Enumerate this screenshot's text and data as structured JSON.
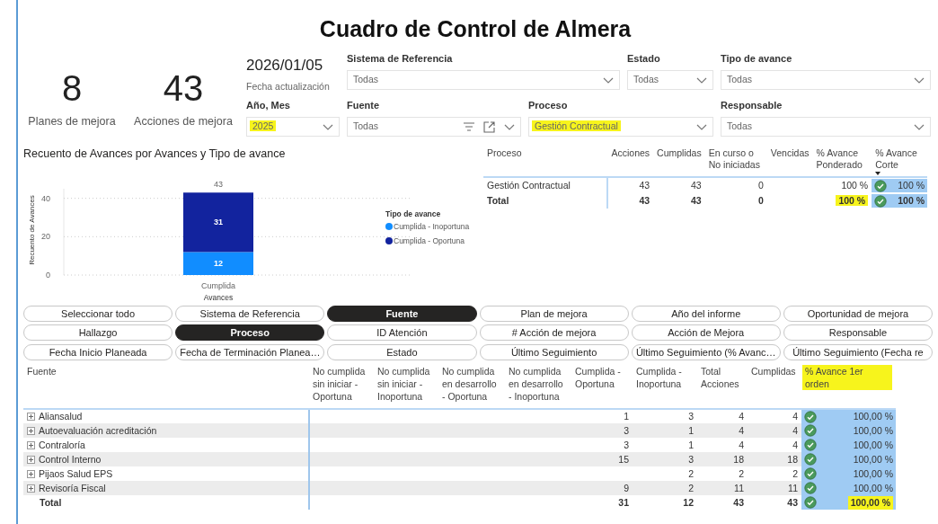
{
  "title": "Cuadro de Control de Almera",
  "kpis": [
    {
      "value": "8",
      "label": "Planes de mejora"
    },
    {
      "value": "43",
      "label": "Acciones de mejora"
    }
  ],
  "update_date": {
    "value": "2026/01/05",
    "label": "Fecha actualización"
  },
  "slicers": [
    {
      "label": "Sistema de Referencia",
      "value": "Todas",
      "highlighted": false
    },
    {
      "label": "Estado",
      "value": "Todas",
      "highlighted": false
    },
    {
      "label": "Tipo de avance",
      "value": "Todas",
      "highlighted": false
    },
    {
      "label": "Año, Mes",
      "value": "2025",
      "highlighted": true
    },
    {
      "label": "Fuente",
      "value": "Todas",
      "highlighted": false
    },
    {
      "label": "Proceso",
      "value": "Gestión Contractual",
      "highlighted": true
    },
    {
      "label": "Responsable",
      "value": "Todas",
      "highlighted": false
    }
  ],
  "chart": {
    "legend_title": "Tipo de avance",
    "chart_data": {
      "type": "bar",
      "stacked": true,
      "title": "Recuento de Avances por Avances y Tipo de avance",
      "xlabel": "Avances",
      "ylabel": "Recuento de Avances",
      "categories": [
        "Cumplida"
      ],
      "series": [
        {
          "name": "Cumplida - Inoportuna",
          "color": "#118dff",
          "values": [
            12
          ]
        },
        {
          "name": "Cumplida - Oportuna",
          "color": "#12239e",
          "values": [
            31
          ]
        }
      ],
      "ylim": [
        0,
        45
      ],
      "yticks": [
        0,
        20,
        40
      ],
      "data_labels": true,
      "legend": "right",
      "annotations": [
        "43"
      ]
    }
  },
  "summary": {
    "columns": [
      {
        "label": "Proceso",
        "sorted": false
      },
      {
        "label": "Acciones",
        "sorted": false
      },
      {
        "label": "Cumplidas",
        "sorted": false
      },
      {
        "label": "En curso o No iniciadas",
        "sorted": false
      },
      {
        "label": "Vencidas",
        "sorted": false
      },
      {
        "label": "% Avance Ponderado",
        "sorted": false
      },
      {
        "label": "% Avance Corte",
        "sorted": true
      }
    ],
    "rows": [
      {
        "kind": "row",
        "label": "Gestión Contractual",
        "acciones": "43",
        "cumplidas": "43",
        "en_curso": "0",
        "weighted": {
          "text": "100 %",
          "highlighted": false
        },
        "cut": "100 %"
      },
      {
        "kind": "total",
        "label": "Total",
        "acciones": "43",
        "cumplidas": "43",
        "en_curso": "0",
        "weighted": {
          "text": "100 %",
          "highlighted": true
        },
        "cut": "100 %"
      }
    ]
  },
  "field_buttons": [
    {
      "label": "Seleccionar todo",
      "selected": false
    },
    {
      "label": "Sistema de Referencia",
      "selected": false
    },
    {
      "label": "Fuente",
      "selected": true
    },
    {
      "label": "Plan de mejora",
      "selected": false
    },
    {
      "label": "Año del informe",
      "selected": false
    },
    {
      "label": "Oportunidad de mejora",
      "selected": false
    },
    {
      "label": "Hallazgo",
      "selected": false
    },
    {
      "label": "Proceso",
      "selected": true
    },
    {
      "label": "ID Atención",
      "selected": false
    },
    {
      "label": "# Acción de mejora",
      "selected": false
    },
    {
      "label": "Acción de Mejora",
      "selected": false
    },
    {
      "label": "Responsable",
      "selected": false
    },
    {
      "label": "Fecha Inicio Planeada",
      "selected": false
    },
    {
      "label": "Fecha de Terminación Planea…",
      "selected": false
    },
    {
      "label": "Estado",
      "selected": false
    },
    {
      "label": "Último Seguimiento",
      "selected": false
    },
    {
      "label": "Último Seguimiento (% Avanc…",
      "selected": false
    },
    {
      "label": "Último Seguimiento (Fecha re",
      "selected": false
    }
  ],
  "matrix": {
    "columns": [
      {
        "label": "Fuente",
        "highlighted": false
      },
      {
        "label": "No cumplida sin iniciar - Oportuna",
        "highlighted": false
      },
      {
        "label": "No cumplida sin iniciar - Inoportuna",
        "highlighted": false
      },
      {
        "label": "No cumplida en desarrollo - Oportuna",
        "highlighted": false
      },
      {
        "label": "No cumplida en desarrollo - Inoportuna",
        "highlighted": false
      },
      {
        "label": "Cumplida - Oportuna",
        "highlighted": false
      },
      {
        "label": "Cumplida - Inoportuna",
        "highlighted": false
      },
      {
        "label": "Total Acciones",
        "highlighted": false
      },
      {
        "label": "Cumplidas",
        "highlighted": false
      },
      {
        "label": "% Avance 1er orden",
        "highlighted": true
      }
    ],
    "rows": [
      {
        "kind": "group",
        "label": "Aliansalud",
        "cumplida_oportuna": "1",
        "cumplida_inoportuna": "3",
        "total_acciones": "4",
        "cumplidas": "4",
        "progress": {
          "text": "100,00 %",
          "highlighted": false
        }
      },
      {
        "kind": "group",
        "label": "Autoevaluación acreditación",
        "cumplida_oportuna": "3",
        "cumplida_inoportuna": "1",
        "total_acciones": "4",
        "cumplidas": "4",
        "progress": {
          "text": "100,00 %",
          "highlighted": false
        }
      },
      {
        "kind": "group",
        "label": "Contraloría",
        "cumplida_oportuna": "3",
        "cumplida_inoportuna": "1",
        "total_acciones": "4",
        "cumplidas": "4",
        "progress": {
          "text": "100,00 %",
          "highlighted": false
        }
      },
      {
        "kind": "group",
        "label": "Control Interno",
        "cumplida_oportuna": "15",
        "cumplida_inoportuna": "3",
        "total_acciones": "18",
        "cumplidas": "18",
        "progress": {
          "text": "100,00 %",
          "highlighted": false
        }
      },
      {
        "kind": "group",
        "label": "Pijaos Salud EPS",
        "cumplida_inoportuna": "2",
        "total_acciones": "2",
        "cumplidas": "2",
        "progress": {
          "text": "100,00 %",
          "highlighted": false
        }
      },
      {
        "kind": "group",
        "label": "Revisoría Fiscal",
        "cumplida_oportuna": "9",
        "cumplida_inoportuna": "2",
        "total_acciones": "11",
        "cumplidas": "11",
        "progress": {
          "text": "100,00 %",
          "highlighted": false
        }
      },
      {
        "kind": "total",
        "label": "Total",
        "cumplida_oportuna": "31",
        "cumplida_inoportuna": "12",
        "total_acciones": "43",
        "cumplidas": "43",
        "progress": {
          "text": "100,00 %",
          "highlighted": true
        }
      }
    ]
  }
}
